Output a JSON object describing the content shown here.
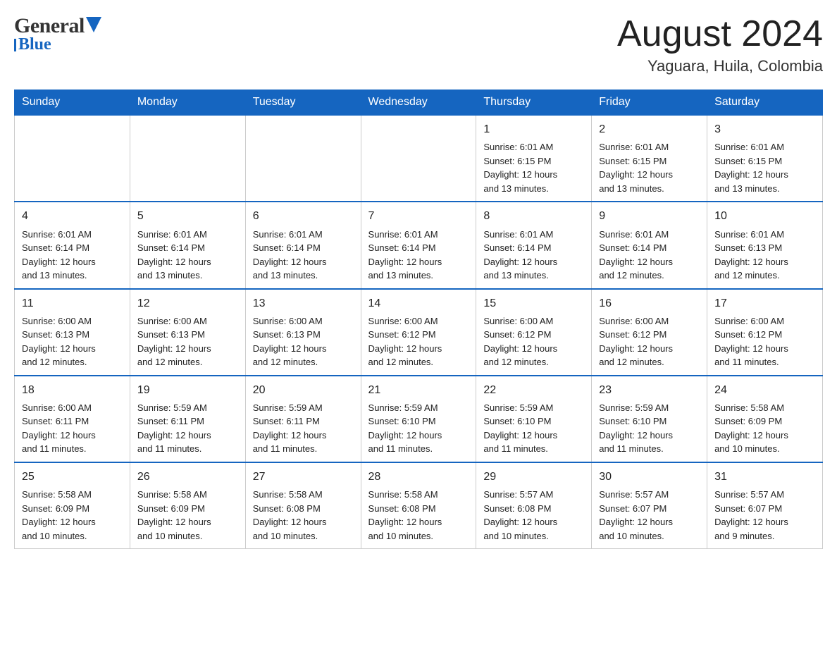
{
  "header": {
    "logo_text_general": "General",
    "logo_text_blue": "Blue",
    "month_title": "August 2024",
    "location": "Yaguara, Huila, Colombia"
  },
  "days_of_week": [
    "Sunday",
    "Monday",
    "Tuesday",
    "Wednesday",
    "Thursday",
    "Friday",
    "Saturday"
  ],
  "weeks": [
    {
      "days": [
        {
          "num": "",
          "info": ""
        },
        {
          "num": "",
          "info": ""
        },
        {
          "num": "",
          "info": ""
        },
        {
          "num": "",
          "info": ""
        },
        {
          "num": "1",
          "info": "Sunrise: 6:01 AM\nSunset: 6:15 PM\nDaylight: 12 hours\nand 13 minutes."
        },
        {
          "num": "2",
          "info": "Sunrise: 6:01 AM\nSunset: 6:15 PM\nDaylight: 12 hours\nand 13 minutes."
        },
        {
          "num": "3",
          "info": "Sunrise: 6:01 AM\nSunset: 6:15 PM\nDaylight: 12 hours\nand 13 minutes."
        }
      ]
    },
    {
      "days": [
        {
          "num": "4",
          "info": "Sunrise: 6:01 AM\nSunset: 6:14 PM\nDaylight: 12 hours\nand 13 minutes."
        },
        {
          "num": "5",
          "info": "Sunrise: 6:01 AM\nSunset: 6:14 PM\nDaylight: 12 hours\nand 13 minutes."
        },
        {
          "num": "6",
          "info": "Sunrise: 6:01 AM\nSunset: 6:14 PM\nDaylight: 12 hours\nand 13 minutes."
        },
        {
          "num": "7",
          "info": "Sunrise: 6:01 AM\nSunset: 6:14 PM\nDaylight: 12 hours\nand 13 minutes."
        },
        {
          "num": "8",
          "info": "Sunrise: 6:01 AM\nSunset: 6:14 PM\nDaylight: 12 hours\nand 13 minutes."
        },
        {
          "num": "9",
          "info": "Sunrise: 6:01 AM\nSunset: 6:14 PM\nDaylight: 12 hours\nand 12 minutes."
        },
        {
          "num": "10",
          "info": "Sunrise: 6:01 AM\nSunset: 6:13 PM\nDaylight: 12 hours\nand 12 minutes."
        }
      ]
    },
    {
      "days": [
        {
          "num": "11",
          "info": "Sunrise: 6:00 AM\nSunset: 6:13 PM\nDaylight: 12 hours\nand 12 minutes."
        },
        {
          "num": "12",
          "info": "Sunrise: 6:00 AM\nSunset: 6:13 PM\nDaylight: 12 hours\nand 12 minutes."
        },
        {
          "num": "13",
          "info": "Sunrise: 6:00 AM\nSunset: 6:13 PM\nDaylight: 12 hours\nand 12 minutes."
        },
        {
          "num": "14",
          "info": "Sunrise: 6:00 AM\nSunset: 6:12 PM\nDaylight: 12 hours\nand 12 minutes."
        },
        {
          "num": "15",
          "info": "Sunrise: 6:00 AM\nSunset: 6:12 PM\nDaylight: 12 hours\nand 12 minutes."
        },
        {
          "num": "16",
          "info": "Sunrise: 6:00 AM\nSunset: 6:12 PM\nDaylight: 12 hours\nand 12 minutes."
        },
        {
          "num": "17",
          "info": "Sunrise: 6:00 AM\nSunset: 6:12 PM\nDaylight: 12 hours\nand 11 minutes."
        }
      ]
    },
    {
      "days": [
        {
          "num": "18",
          "info": "Sunrise: 6:00 AM\nSunset: 6:11 PM\nDaylight: 12 hours\nand 11 minutes."
        },
        {
          "num": "19",
          "info": "Sunrise: 5:59 AM\nSunset: 6:11 PM\nDaylight: 12 hours\nand 11 minutes."
        },
        {
          "num": "20",
          "info": "Sunrise: 5:59 AM\nSunset: 6:11 PM\nDaylight: 12 hours\nand 11 minutes."
        },
        {
          "num": "21",
          "info": "Sunrise: 5:59 AM\nSunset: 6:10 PM\nDaylight: 12 hours\nand 11 minutes."
        },
        {
          "num": "22",
          "info": "Sunrise: 5:59 AM\nSunset: 6:10 PM\nDaylight: 12 hours\nand 11 minutes."
        },
        {
          "num": "23",
          "info": "Sunrise: 5:59 AM\nSunset: 6:10 PM\nDaylight: 12 hours\nand 11 minutes."
        },
        {
          "num": "24",
          "info": "Sunrise: 5:58 AM\nSunset: 6:09 PM\nDaylight: 12 hours\nand 10 minutes."
        }
      ]
    },
    {
      "days": [
        {
          "num": "25",
          "info": "Sunrise: 5:58 AM\nSunset: 6:09 PM\nDaylight: 12 hours\nand 10 minutes."
        },
        {
          "num": "26",
          "info": "Sunrise: 5:58 AM\nSunset: 6:09 PM\nDaylight: 12 hours\nand 10 minutes."
        },
        {
          "num": "27",
          "info": "Sunrise: 5:58 AM\nSunset: 6:08 PM\nDaylight: 12 hours\nand 10 minutes."
        },
        {
          "num": "28",
          "info": "Sunrise: 5:58 AM\nSunset: 6:08 PM\nDaylight: 12 hours\nand 10 minutes."
        },
        {
          "num": "29",
          "info": "Sunrise: 5:57 AM\nSunset: 6:08 PM\nDaylight: 12 hours\nand 10 minutes."
        },
        {
          "num": "30",
          "info": "Sunrise: 5:57 AM\nSunset: 6:07 PM\nDaylight: 12 hours\nand 10 minutes."
        },
        {
          "num": "31",
          "info": "Sunrise: 5:57 AM\nSunset: 6:07 PM\nDaylight: 12 hours\nand 9 minutes."
        }
      ]
    }
  ]
}
